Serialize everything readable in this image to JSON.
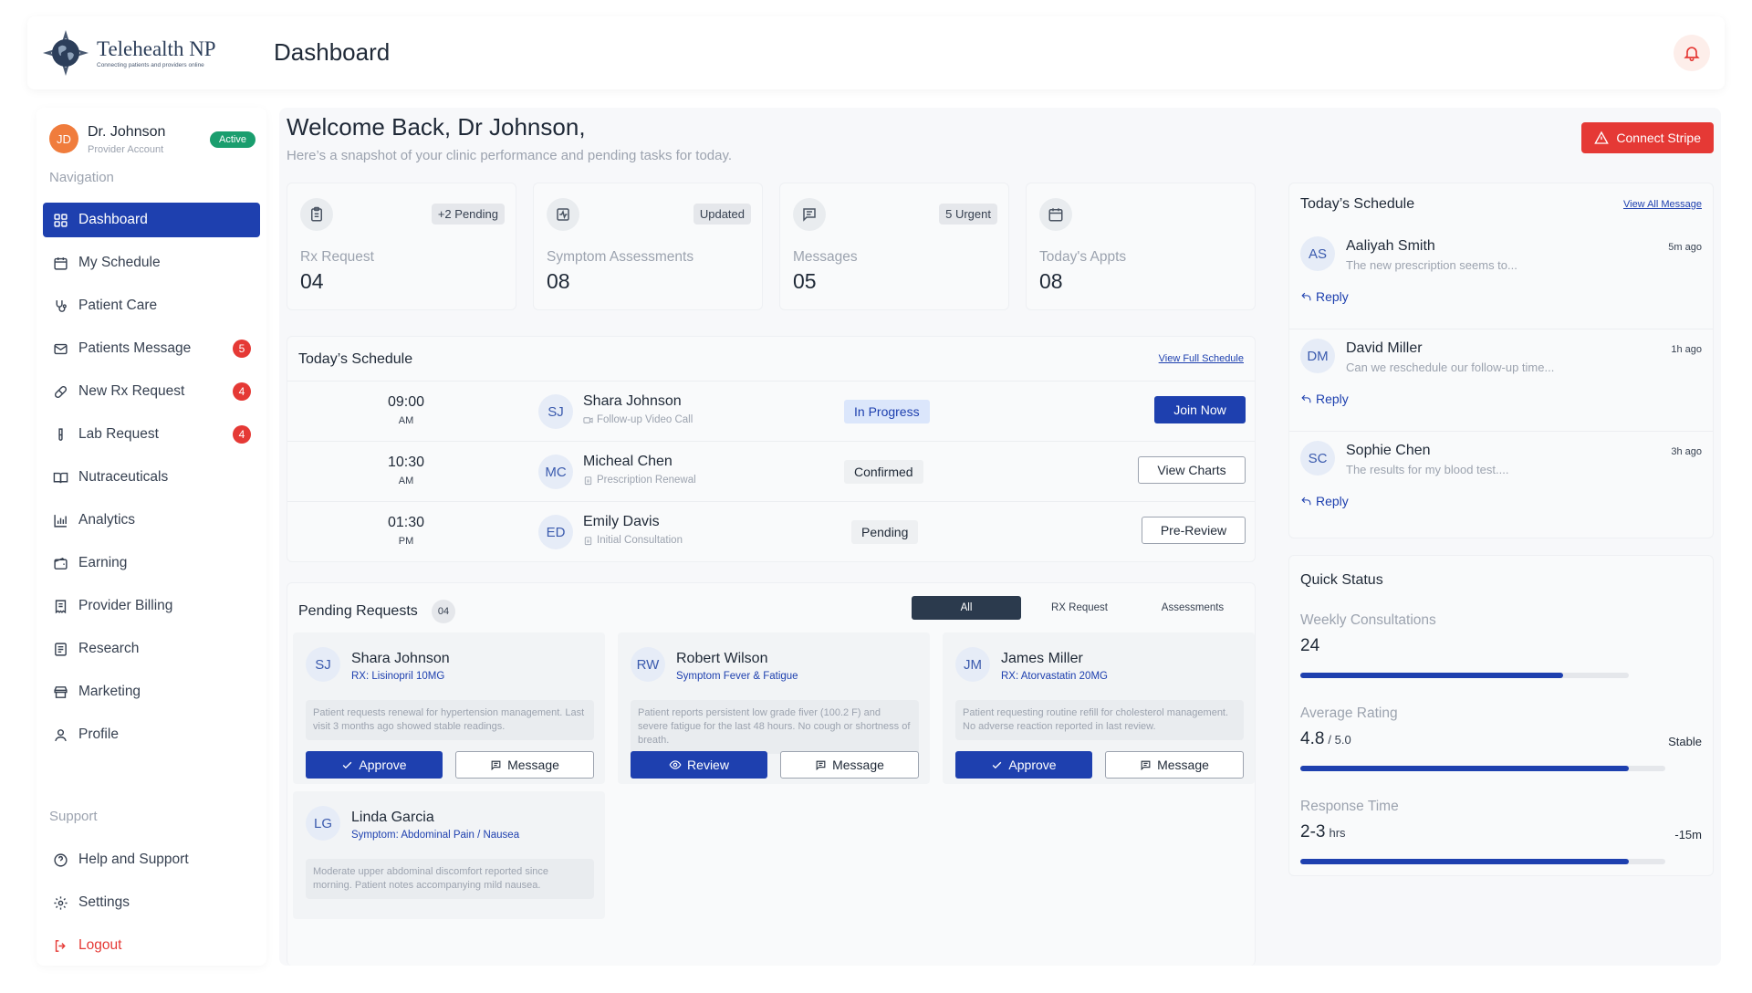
{
  "header": {
    "logo_name": "Telehealth NP",
    "logo_tagline": "Connecting patients and providers online",
    "page_title": "Dashboard"
  },
  "profile": {
    "initials": "JD",
    "name": "Dr. Johnson",
    "role": "Provider Account",
    "status": "Active"
  },
  "nav": {
    "heading": "Navigation",
    "items": [
      {
        "label": "Dashboard",
        "icon": "grid-icon",
        "active": true
      },
      {
        "label": "My Schedule",
        "icon": "calendar-icon"
      },
      {
        "label": "Patient Care",
        "icon": "stethoscope-icon"
      },
      {
        "label": "Patients Message",
        "icon": "mail-icon",
        "badge": "5"
      },
      {
        "label": "New Rx Request",
        "icon": "pill-icon",
        "badge": "4"
      },
      {
        "label": "Lab Request",
        "icon": "test-tube-icon",
        "badge": "4"
      },
      {
        "label": "Nutraceuticals",
        "icon": "book-icon"
      },
      {
        "label": "Analytics",
        "icon": "bar-chart-icon"
      },
      {
        "label": "Earning",
        "icon": "wallet-icon"
      },
      {
        "label": "Provider Billing",
        "icon": "receipt-icon"
      },
      {
        "label": "Research",
        "icon": "document-icon"
      },
      {
        "label": "Marketing",
        "icon": "store-icon"
      },
      {
        "label": "Profile",
        "icon": "user-icon"
      }
    ],
    "support_heading": "Support",
    "support_items": [
      {
        "label": "Help and Support",
        "icon": "help-circle-icon"
      },
      {
        "label": "Settings",
        "icon": "gear-icon"
      },
      {
        "label": "Logout",
        "icon": "logout-icon"
      }
    ]
  },
  "main": {
    "welcome": "Welcome Back, Dr Johnson,",
    "subtitle": "Here’s a snapshot of your clinic performance and pending tasks for today.",
    "connect_stripe": "Connect Stripe"
  },
  "stats": [
    {
      "label": "Rx Request",
      "value": "04",
      "badge": "+2 Pending",
      "icon": "clipboard-icon"
    },
    {
      "label": "Symptom Assessments",
      "value": "08",
      "badge": "Updated",
      "icon": "activity-icon"
    },
    {
      "label": "Messages",
      "value": "05",
      "badge": "5 Urgent",
      "icon": "message-icon"
    },
    {
      "label": "Today's Appts",
      "value": "08",
      "badge": "",
      "icon": "calendar-icon"
    }
  ],
  "schedule": {
    "title": "Today’s Schedule",
    "link": "View Full Schedule",
    "rows": [
      {
        "time": "09:00",
        "ampm": "AM",
        "initials": "SJ",
        "name": "Shara Johnson",
        "type": "Follow-up Video Call",
        "status": "In Progress",
        "action": "Join Now"
      },
      {
        "time": "10:30",
        "ampm": "AM",
        "initials": "MC",
        "name": "Micheal Chen",
        "type": "Prescription Renewal",
        "status": "Confirmed",
        "action": "View Charts"
      },
      {
        "time": "01:30",
        "ampm": "PM",
        "initials": "ED",
        "name": "Emily Davis",
        "type": "Initial Consultation",
        "status": "Pending",
        "action": "Pre-Review"
      }
    ]
  },
  "pending": {
    "title": "Pending Requests",
    "count": "04",
    "tabs": [
      "All",
      "RX Request",
      "Assessments"
    ],
    "cards": [
      {
        "initials": "SJ",
        "name": "Shara Johnson",
        "rx": "RX: Lisinopril 10MG",
        "note": "Patient requests renewal for hypertension management. Last visit 3 months ago showed stable readings.",
        "primary": "Approve",
        "secondary": "Message"
      },
      {
        "initials": "RW",
        "name": "Robert Wilson",
        "rx": "Symptom Fever & Fatigue",
        "note": "Patient reports persistent low grade fiver (100.2 F) and severe fatigue for the last  48 hours. No cough or shortness of breath.",
        "primary": "Review",
        "secondary": "Message"
      },
      {
        "initials": "JM",
        "name": "James Miller",
        "rx": "RX: Atorvastatin 20MG",
        "note": "Patient requesting routine refill for cholesterol management. No adverse reaction reported in last review.",
        "primary": "Approve",
        "secondary": "Message"
      },
      {
        "initials": "LG",
        "name": "Linda Garcia",
        "rx": "Symptom: Abdominal Pain / Nausea",
        "note": "Moderate upper abdominal discomfort reported since morning. Patient notes accompanying mild nausea."
      }
    ]
  },
  "messages": {
    "title": "Today’s Schedule",
    "link": "View All Message",
    "reply_label": "Reply",
    "items": [
      {
        "initials": "AS",
        "name": "Aaliyah Smith",
        "text": "The new prescription seems to...",
        "time": "5m ago"
      },
      {
        "initials": "DM",
        "name": "David Miller",
        "text": "Can we reschedule our follow-up time...",
        "time": "1h ago"
      },
      {
        "initials": "SC",
        "name": "Sophie Chen",
        "text": "The results for my blood test....",
        "time": "3h ago"
      }
    ]
  },
  "quick_status": {
    "title": "Quick Status",
    "items": [
      {
        "label": "Weekly Consultations",
        "value": "24",
        "unit": "",
        "right": "",
        "progress": 0.8
      },
      {
        "label": "Average Rating",
        "value": "4.8",
        "unit": "/ 5.0",
        "right": "Stable",
        "progress": 0.9
      },
      {
        "label": "Response Time",
        "value": "2-3",
        "unit": "hrs",
        "right": "-15m",
        "progress": 0.9
      }
    ]
  },
  "colors": {
    "primary": "#1e40af",
    "danger": "#e53935",
    "success": "#1a9e6e",
    "avatar": "#f07c3c"
  }
}
